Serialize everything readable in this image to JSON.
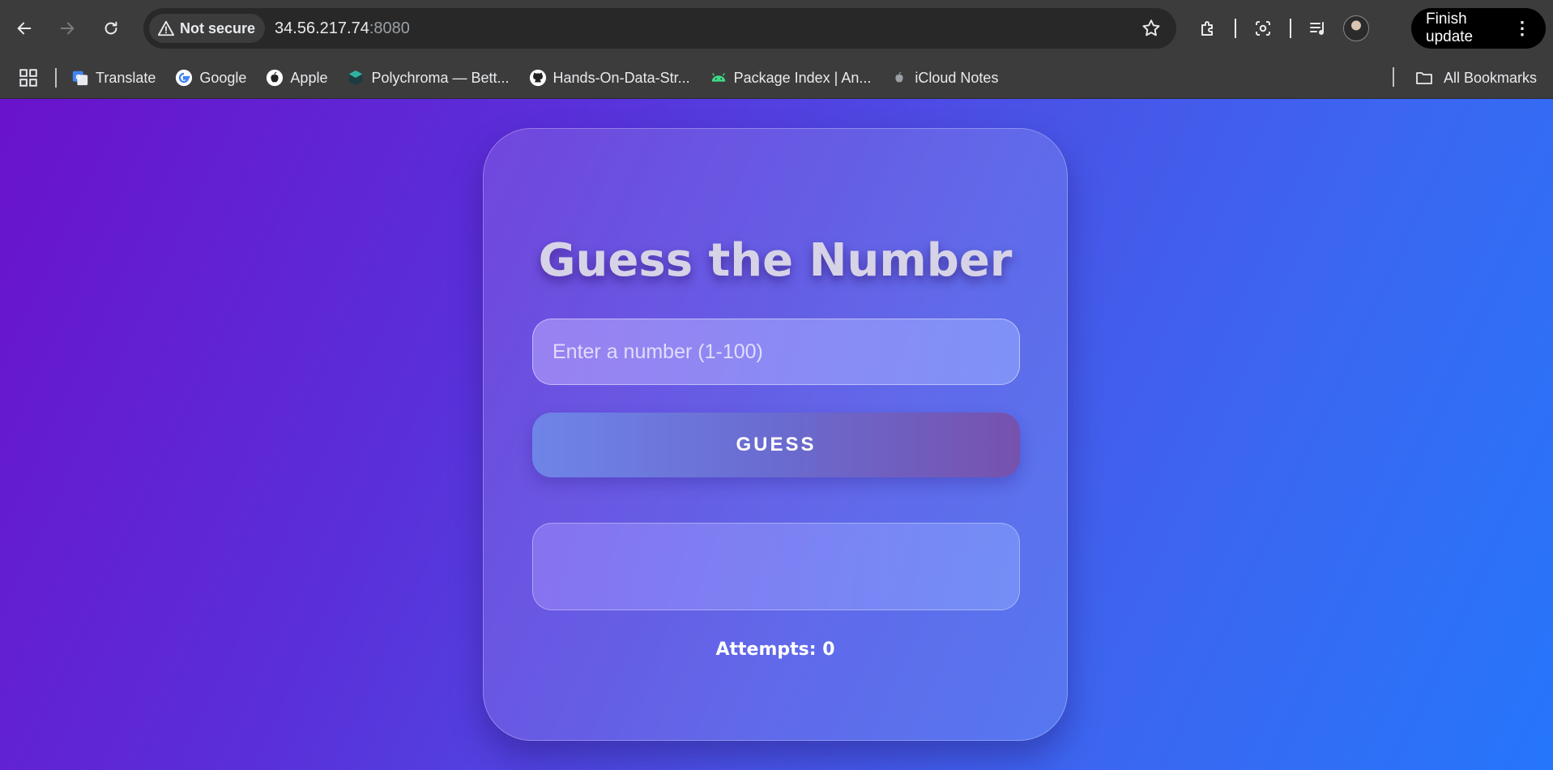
{
  "browser": {
    "security_label": "Not secure",
    "url_host": "34.56.217.74",
    "url_port": ":8080",
    "finish_update_label": "Finish update",
    "bookmarks": [
      {
        "label": "Translate",
        "icon": "translate-icon"
      },
      {
        "label": "Google",
        "icon": "google-icon"
      },
      {
        "label": "Apple",
        "icon": "apple-icon"
      },
      {
        "label": "Polychroma — Bett...",
        "icon": "polychroma-icon"
      },
      {
        "label": "Hands-On-Data-Str...",
        "icon": "github-icon"
      },
      {
        "label": "Package Index | An...",
        "icon": "android-icon"
      },
      {
        "label": "iCloud Notes",
        "icon": "apple-icon"
      }
    ],
    "all_bookmarks_label": "All Bookmarks"
  },
  "game": {
    "title": "Guess the Number",
    "input_placeholder": "Enter a number (1-100)",
    "guess_button_label": "GUESS",
    "result_message": "",
    "attempts_label": "Attempts: 0"
  }
}
